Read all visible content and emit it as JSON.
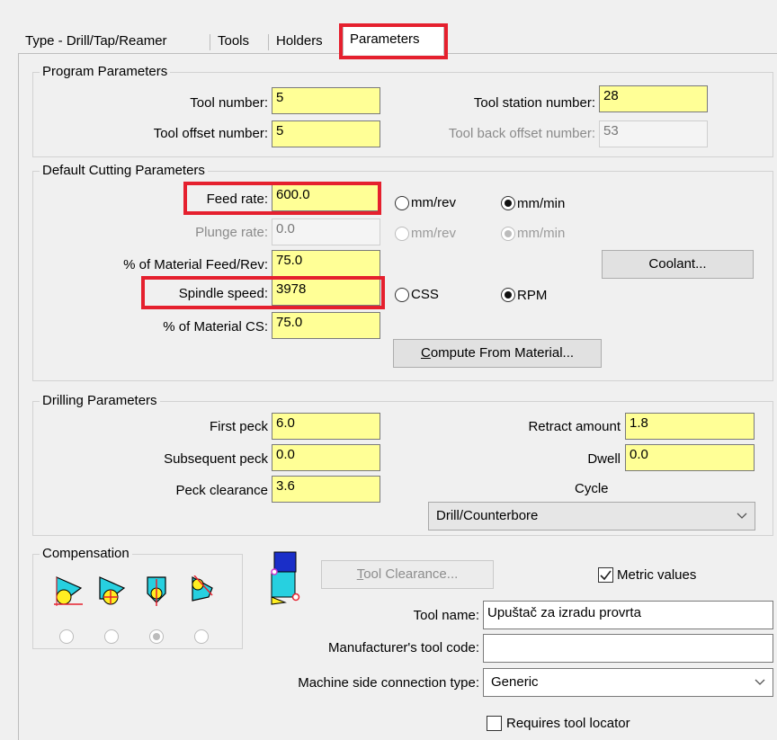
{
  "tabs": [
    "Type - Drill/Tap/Reamer",
    "Tools",
    "Holders",
    "Parameters"
  ],
  "program": {
    "title": "Program Parameters",
    "tool_number_label": "Tool number:",
    "tool_number": "5",
    "tool_offset_label": "Tool offset number:",
    "tool_offset": "5",
    "station_label": "Tool station number:",
    "station": "28",
    "back_offset_label": "Tool back offset number:",
    "back_offset": "53"
  },
  "cutting": {
    "title": "Default Cutting Parameters",
    "feed_rate_label": "Feed rate:",
    "feed_rate": "600.0",
    "plunge_rate_label": "Plunge rate:",
    "plunge_rate": "0.0",
    "material_feed_label": "% of Material Feed/Rev:",
    "material_feed": "75.0",
    "spindle_speed_label": "Spindle speed:",
    "spindle_speed": "3978",
    "material_cs_label": "% of Material CS:",
    "material_cs": "75.0",
    "mmrev": "mm/rev",
    "mmmin": "mm/min",
    "css": "CSS",
    "rpm": "RPM",
    "coolant": "Coolant...",
    "compute_u": "C",
    "compute_rest": "ompute From Material..."
  },
  "drilling": {
    "title": "Drilling Parameters",
    "first_peck_label": "First peck",
    "first_peck": "6.0",
    "subsequent_peck_label": "Subsequent peck",
    "subsequent_peck": "0.0",
    "peck_clearance_label": "Peck clearance",
    "peck_clearance": "3.6",
    "retract_label": "Retract amount",
    "retract": "1.8",
    "dwell_label": "Dwell",
    "dwell": "0.0",
    "cycle_label": "Cycle",
    "cycle": "Drill/Counterbore"
  },
  "compensation": {
    "title": "Compensation",
    "tool_clearance_u": "T",
    "tool_clearance_rest": "ool Clearance...",
    "metric_values": "Metric values",
    "tool_name_label": "Tool name:",
    "tool_name": "Upuštač za izradu provrta",
    "mfr_code_label": "Manufacturer's tool code:",
    "mfr_code": "",
    "connection_label": "Machine side connection type:",
    "connection": "Generic",
    "requires_locator": "Requires tool locator"
  },
  "colors": {
    "field_yellow": "#ffff96",
    "highlight_red": "#e5202e"
  }
}
